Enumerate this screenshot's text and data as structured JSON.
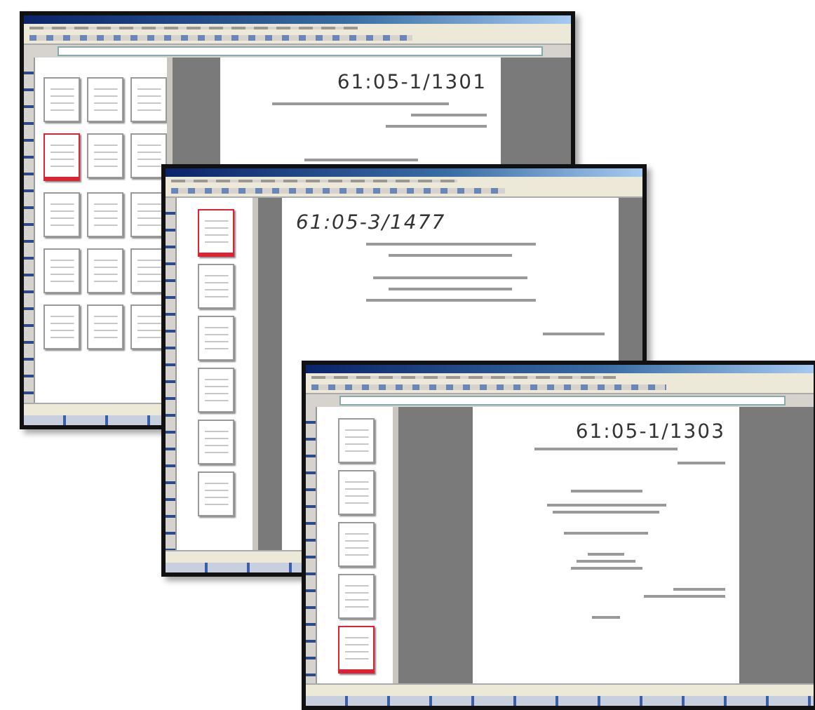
{
  "windows": [
    {
      "kind": "grid",
      "stamp": "61:05-1/1301",
      "thumbnails": [
        {
          "selected": false
        },
        {
          "selected": false
        },
        {
          "selected": false
        },
        {
          "selected": true
        },
        {
          "selected": false
        },
        {
          "selected": false
        },
        {
          "selected": false
        },
        {
          "selected": false
        },
        {
          "selected": false
        },
        {
          "selected": false
        },
        {
          "selected": false
        },
        {
          "selected": false
        },
        {
          "selected": false
        },
        {
          "selected": false
        },
        {
          "selected": false
        }
      ]
    },
    {
      "kind": "column",
      "stamp": "61:05-3/1477",
      "thumbnails": [
        {
          "selected": true
        },
        {
          "selected": false
        },
        {
          "selected": false
        },
        {
          "selected": false
        },
        {
          "selected": false
        },
        {
          "selected": false
        }
      ]
    },
    {
      "kind": "column",
      "stamp": "61:05-1/1303",
      "thumbnails": [
        {
          "selected": false
        },
        {
          "selected": false
        },
        {
          "selected": false
        },
        {
          "selected": false
        },
        {
          "selected": true
        }
      ]
    }
  ]
}
